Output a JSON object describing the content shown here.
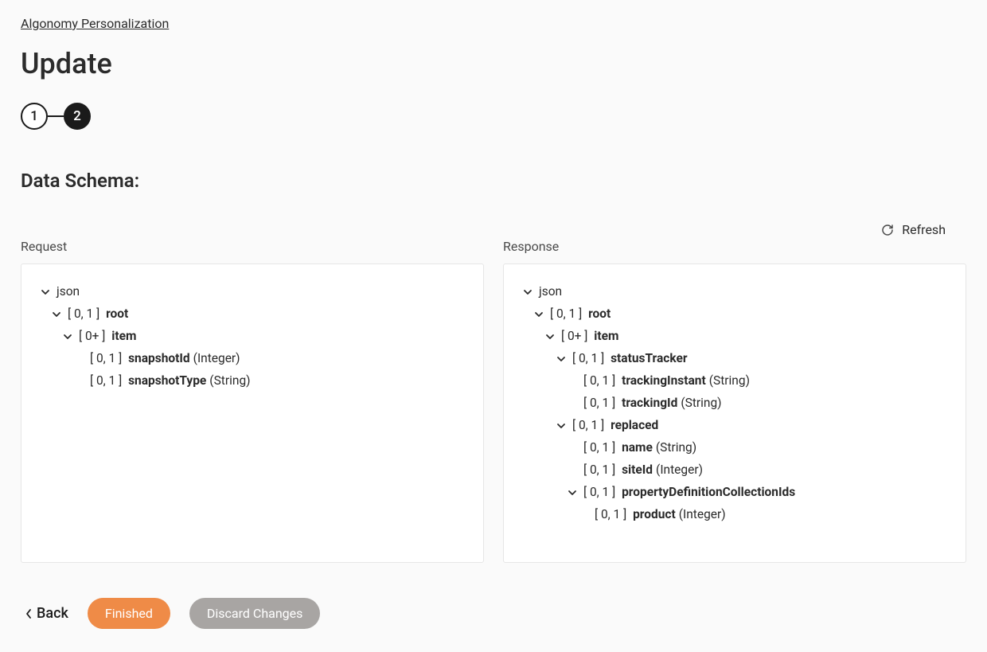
{
  "breadcrumb": "Algonomy Personalization",
  "page_title": "Update",
  "stepper": {
    "step1": "1",
    "step2": "2"
  },
  "section_title": "Data Schema:",
  "refresh_label": "Refresh",
  "request_label": "Request",
  "response_label": "Response",
  "request_tree": [
    {
      "lvl": 0,
      "expandable": true,
      "card": "",
      "name": "json",
      "type": "",
      "bold": false
    },
    {
      "lvl": 1,
      "expandable": true,
      "card": "[ 0, 1 ]",
      "name": "root",
      "type": "",
      "bold": true
    },
    {
      "lvl": 2,
      "expandable": true,
      "card": "[ 0+ ]",
      "name": "item",
      "type": "",
      "bold": true
    },
    {
      "lvl": 3,
      "expandable": false,
      "card": "[ 0, 1 ]",
      "name": "snapshotId",
      "type": "(Integer)",
      "bold": true
    },
    {
      "lvl": 3,
      "expandable": false,
      "card": "[ 0, 1 ]",
      "name": "snapshotType",
      "type": "(String)",
      "bold": true
    }
  ],
  "response_tree": [
    {
      "lvl": 0,
      "expandable": true,
      "card": "",
      "name": "json",
      "type": "",
      "bold": false
    },
    {
      "lvl": 1,
      "expandable": true,
      "card": "[ 0, 1 ]",
      "name": "root",
      "type": "",
      "bold": true
    },
    {
      "lvl": 2,
      "expandable": true,
      "card": "[ 0+ ]",
      "name": "item",
      "type": "",
      "bold": true
    },
    {
      "lvl": 3,
      "expandable": true,
      "card": "[ 0, 1 ]",
      "name": "statusTracker",
      "type": "",
      "bold": true
    },
    {
      "lvl": 4,
      "expandable": false,
      "card": "[ 0, 1 ]",
      "name": "trackingInstant",
      "type": "(String)",
      "bold": true
    },
    {
      "lvl": 4,
      "expandable": false,
      "card": "[ 0, 1 ]",
      "name": "trackingId",
      "type": "(String)",
      "bold": true
    },
    {
      "lvl": 3,
      "expandable": true,
      "card": "[ 0, 1 ]",
      "name": "replaced",
      "type": "",
      "bold": true
    },
    {
      "lvl": 4,
      "expandable": false,
      "card": "[ 0, 1 ]",
      "name": "name",
      "type": "(String)",
      "bold": true
    },
    {
      "lvl": 4,
      "expandable": false,
      "card": "[ 0, 1 ]",
      "name": "siteId",
      "type": "(Integer)",
      "bold": true
    },
    {
      "lvl": 4,
      "expandable": true,
      "card": "[ 0, 1 ]",
      "name": "propertyDefinitionCollectionIds",
      "type": "",
      "bold": true
    },
    {
      "lvl": 5,
      "expandable": false,
      "card": "[ 0, 1 ]",
      "name": "product",
      "type": "(Integer)",
      "bold": true
    }
  ],
  "footer": {
    "back": "Back",
    "finished": "Finished",
    "discard": "Discard Changes"
  }
}
